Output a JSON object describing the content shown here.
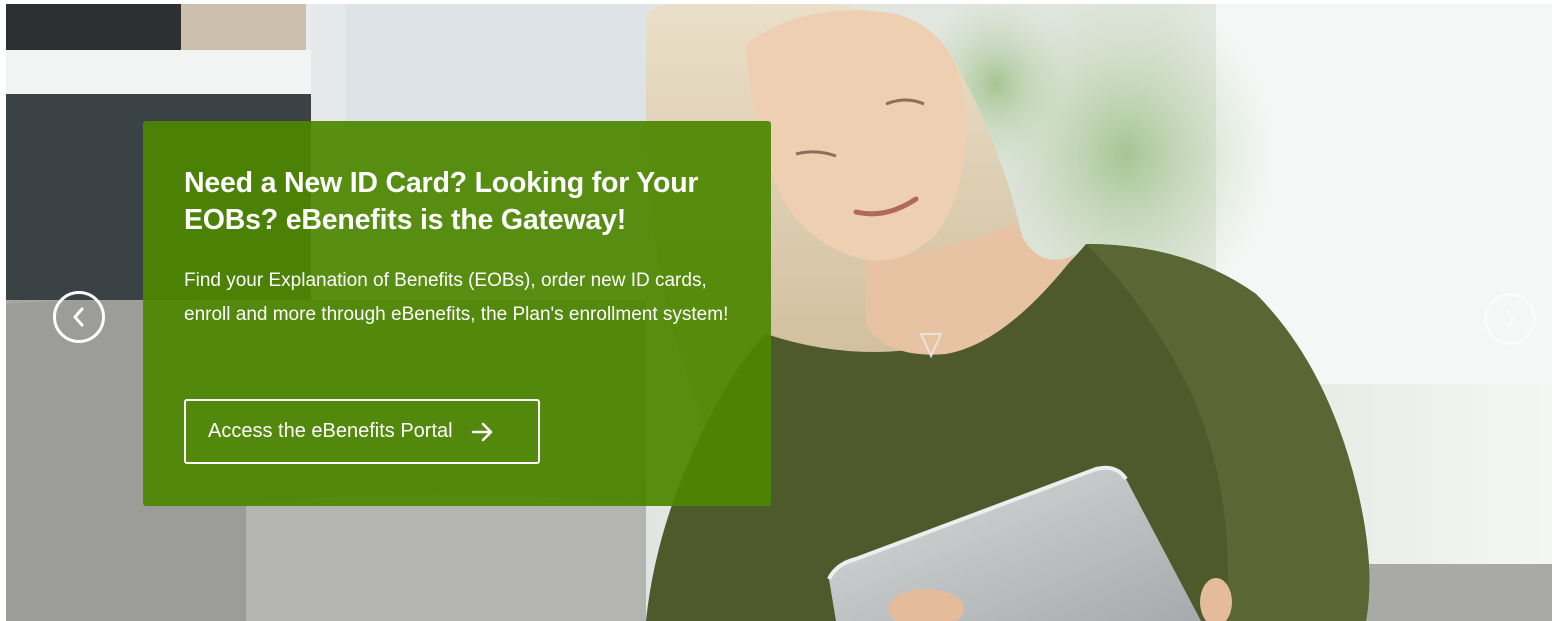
{
  "hero": {
    "heading": "Need a New ID Card? Looking for Your EOBs? eBenefits is the Gateway!",
    "body": "Find your Explanation of Benefits (EOBs), order new ID cards, enroll and more through eBenefits, the Plan's enrollment system!",
    "cta_label": "Access the eBenefits Portal",
    "cta_icon": "arrow-right-icon",
    "background": "woman-with-tablet-on-sofa-photo",
    "panel_color": "#4c8600"
  },
  "carousel": {
    "prev_icon": "chevron-left-icon",
    "next_icon": "chevron-right-icon"
  }
}
